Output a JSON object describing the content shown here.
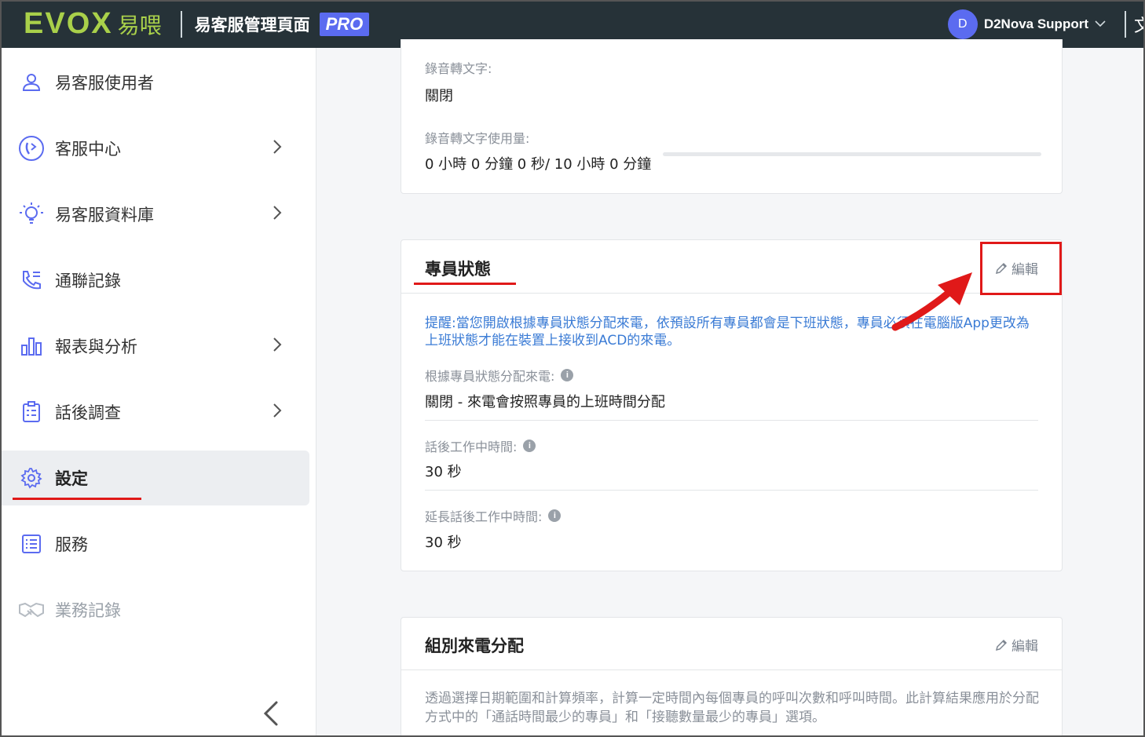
{
  "header": {
    "logo_text": "EVOX",
    "logo_cn": "易喂",
    "app_title": "易客服管理頁面",
    "badge": "PRO",
    "user_initial": "D",
    "user_name": "D2Nova Support",
    "lang_glyph": "文"
  },
  "sidebar": {
    "items": [
      {
        "label": "易客服使用者",
        "icon": "user-icon",
        "has_chevron": false
      },
      {
        "label": "客服中心",
        "icon": "call-center-icon",
        "has_chevron": true
      },
      {
        "label": "易客服資料庫",
        "icon": "lightbulb-icon",
        "has_chevron": true
      },
      {
        "label": "通聯記錄",
        "icon": "phone-log-icon",
        "has_chevron": false
      },
      {
        "label": "報表與分析",
        "icon": "bar-chart-icon",
        "has_chevron": true
      },
      {
        "label": "話後調查",
        "icon": "clipboard-icon",
        "has_chevron": true
      },
      {
        "label": "設定",
        "icon": "gear-icon",
        "has_chevron": false,
        "active": true
      },
      {
        "label": "服務",
        "icon": "service-list-icon",
        "has_chevron": false
      },
      {
        "label": "業務記錄",
        "icon": "handshake-icon",
        "has_chevron": false,
        "disabled": true
      }
    ]
  },
  "recording_card": {
    "transcription_label": "錄音轉文字:",
    "transcription_value": "關閉",
    "usage_label": "錄音轉文字使用量:",
    "usage_value": "0 小時 0 分鐘 0 秒/ 10 小時 0 分鐘",
    "usage_fraction": 0
  },
  "agent_status_card": {
    "title": "專員狀態",
    "edit_label": "編輯",
    "notice": "提醒:當您開啟根據專員狀態分配來電，依預設所有專員都會是下班狀態，專員必須在電腦版App更改為上班狀態才能在裝置上接收到ACD的來電。",
    "fields": [
      {
        "label": "根據專員狀態分配來電:",
        "value": "關閉 - 來電會按照專員的上班時間分配"
      },
      {
        "label": "話後工作中時間:",
        "value": "30 秒"
      },
      {
        "label": "延長話後工作中時間:",
        "value": "30 秒"
      }
    ]
  },
  "group_call_card": {
    "title": "組別來電分配",
    "edit_label": "編輯",
    "description": "透過選擇日期範圍和計算頻率，計算一定時間內每個專員的呼叫次數和呼叫時間。此計算結果應用於分配方式中的「通話時間最少的專員」和「接聽數量最少的專員」選項。"
  },
  "colors": {
    "topbar": "#263238",
    "accent": "#5b6bf0",
    "logo_green": "#a9d04a",
    "notice_blue": "#3a7bd5",
    "annotation_red": "#e01919"
  }
}
